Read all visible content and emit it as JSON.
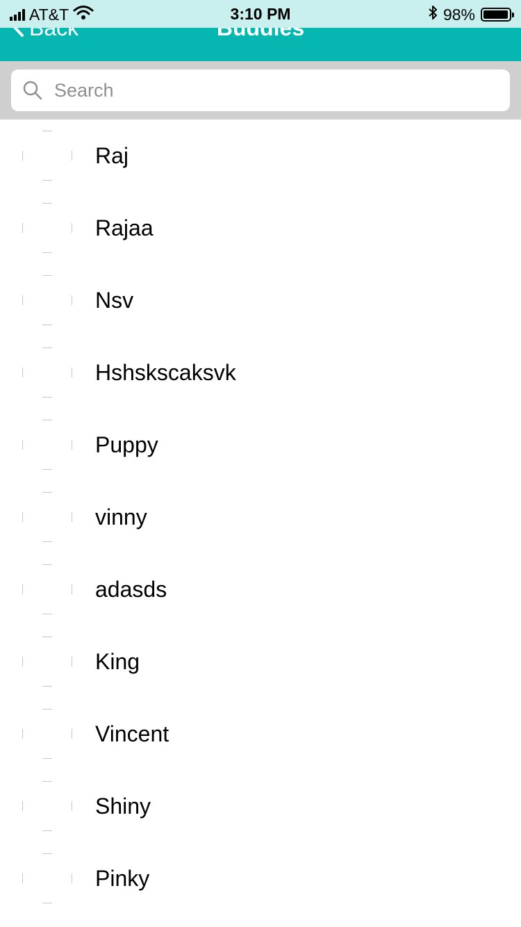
{
  "status_bar": {
    "carrier": "AT&T",
    "time": "3:10 PM",
    "battery_percent": "98%",
    "battery_level": 0.98,
    "signal_bars": 4,
    "icons": [
      "cellular-signal-icon",
      "wifi-icon",
      "bluetooth-icon",
      "battery-icon"
    ]
  },
  "nav": {
    "back_label": "Back",
    "title": "Buddies"
  },
  "search": {
    "placeholder": "Search",
    "value": ""
  },
  "buddies": [
    {
      "name": "Raj"
    },
    {
      "name": "Rajaa"
    },
    {
      "name": "Nsv"
    },
    {
      "name": "Hshskscaksvk"
    },
    {
      "name": "Puppy"
    },
    {
      "name": "vinny"
    },
    {
      "name": "adasds"
    },
    {
      "name": "King"
    },
    {
      "name": "Vincent"
    },
    {
      "name": "Shiny"
    },
    {
      "name": "Pinky"
    }
  ],
  "colors": {
    "nav_background": "#05b6b1",
    "status_background": "#c9efee",
    "search_background": "#cfcfcf"
  }
}
